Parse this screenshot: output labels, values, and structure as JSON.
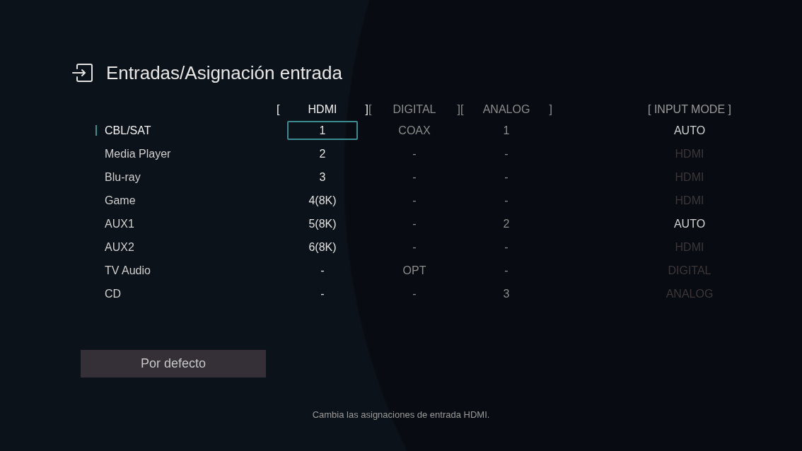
{
  "title": "Entradas/Asignación entrada",
  "columns": [
    {
      "open_bracket": "[",
      "label": "HDMI",
      "close_bracket": "]",
      "active": true
    },
    {
      "open_bracket": "[",
      "label": "DIGITAL",
      "close_bracket": "]",
      "active": false
    },
    {
      "open_bracket": "[",
      "label": "ANALOG",
      "close_bracket": "]",
      "active": false
    }
  ],
  "mode_header": "[ INPUT MODE ]",
  "rows": [
    {
      "name": "CBL/SAT",
      "selected": true,
      "cells": [
        {
          "value": "1",
          "focused": true
        },
        {
          "value": "COAX",
          "focused": false
        },
        {
          "value": "1",
          "focused": false
        }
      ],
      "input_mode": {
        "value": "AUTO",
        "disabled": false
      }
    },
    {
      "name": "Media Player",
      "selected": false,
      "cells": [
        {
          "value": "2",
          "focused": false
        },
        {
          "value": "-",
          "focused": false
        },
        {
          "value": "-",
          "focused": false
        }
      ],
      "input_mode": {
        "value": "HDMI",
        "disabled": true
      }
    },
    {
      "name": "Blu-ray",
      "selected": false,
      "cells": [
        {
          "value": "3",
          "focused": false
        },
        {
          "value": "-",
          "focused": false
        },
        {
          "value": "-",
          "focused": false
        }
      ],
      "input_mode": {
        "value": "HDMI",
        "disabled": true
      }
    },
    {
      "name": "Game",
      "selected": false,
      "cells": [
        {
          "value": "4(8K)",
          "focused": false
        },
        {
          "value": "-",
          "focused": false
        },
        {
          "value": "-",
          "focused": false
        }
      ],
      "input_mode": {
        "value": "HDMI",
        "disabled": true
      }
    },
    {
      "name": "AUX1",
      "selected": false,
      "cells": [
        {
          "value": "5(8K)",
          "focused": false
        },
        {
          "value": "-",
          "focused": false
        },
        {
          "value": "2",
          "focused": false
        }
      ],
      "input_mode": {
        "value": "AUTO",
        "disabled": false
      }
    },
    {
      "name": "AUX2",
      "selected": false,
      "cells": [
        {
          "value": "6(8K)",
          "focused": false
        },
        {
          "value": "-",
          "focused": false
        },
        {
          "value": "-",
          "focused": false
        }
      ],
      "input_mode": {
        "value": "HDMI",
        "disabled": true
      }
    },
    {
      "name": "TV Audio",
      "selected": false,
      "cells": [
        {
          "value": "-",
          "focused": false
        },
        {
          "value": "OPT",
          "focused": false
        },
        {
          "value": "-",
          "focused": false
        }
      ],
      "input_mode": {
        "value": "DIGITAL",
        "disabled": true
      }
    },
    {
      "name": "CD",
      "selected": false,
      "cells": [
        {
          "value": "-",
          "focused": false
        },
        {
          "value": "-",
          "focused": false
        },
        {
          "value": "3",
          "focused": false
        }
      ],
      "input_mode": {
        "value": "ANALOG",
        "disabled": true
      }
    }
  ],
  "default_button": "Por defecto",
  "hint": "Cambia las asignaciones de entrada HDMI."
}
